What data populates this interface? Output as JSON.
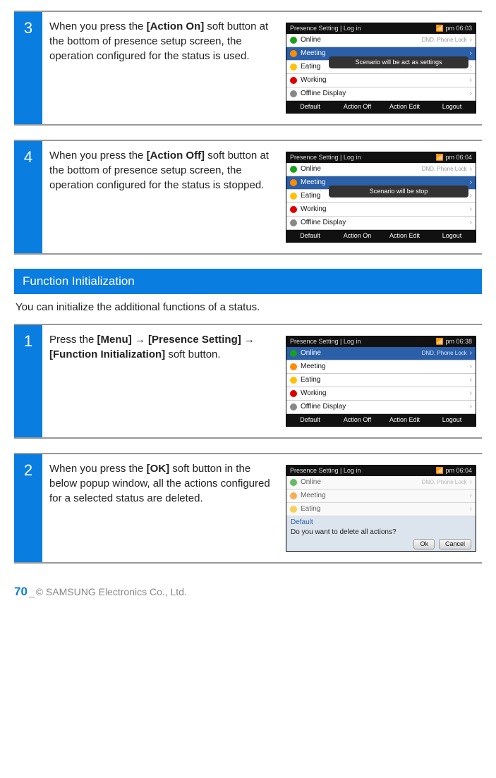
{
  "steps": {
    "s3": {
      "num": "3",
      "text_pre": "When you press the ",
      "bold": "[Action On]",
      "text_post": " soft button at the bottom of presence setup screen, the operation configured for the status is used."
    },
    "s4": {
      "num": "4",
      "text_pre": "When you press the ",
      "bold": "[Action Off]",
      "text_post": " soft button at the bottom of presence setup screen, the operation configured for the status is stopped."
    },
    "fi1": {
      "num": "1",
      "text_pre": "Press the ",
      "bold": "[Menu] → [Presence Setting] → [Function Initialization]",
      "text_post": " soft button."
    },
    "fi2": {
      "num": "2",
      "text_pre": "When you press the ",
      "bold": "[OK]",
      "text_post": " soft button in the below popup window, all the actions configured for a selected status are deleted."
    }
  },
  "section": {
    "title": "Function Initialization",
    "intro": "You can initialize the additional functions of a status."
  },
  "phone": {
    "bar_title": "Presence Setting  | Log in",
    "clock_a": "pm 06:03",
    "clock_b": "pm 06:04",
    "clock_c": "pm 06:38",
    "clock_d": "pm 06:04",
    "items": {
      "online": "Online",
      "meeting": "Meeting",
      "eating": "Eating",
      "working": "Working",
      "offline": "Offline Display"
    },
    "badge": "DND, Phone Lock",
    "soft": {
      "default": "Default",
      "on": "Action On",
      "off": "Action Off",
      "edit": "Action Edit",
      "logout": "Logout"
    },
    "toast_on": "Scenario will be act as settings",
    "toast_off": "Scenario will be stop",
    "popup": {
      "title": "Default",
      "msg": "Do you want to delete all actions?",
      "ok": "Ok",
      "cancel": "Cancel"
    }
  },
  "footer": {
    "page": "70",
    "sep": "_ ",
    "copyright": "© SAMSUNG Electronics Co., Ltd."
  }
}
